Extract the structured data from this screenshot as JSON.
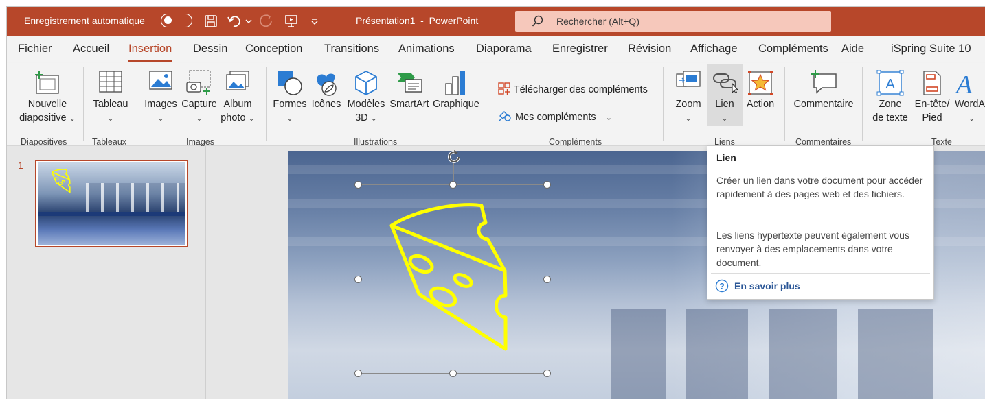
{
  "titlebar": {
    "autosave_label": "Enregistrement automatique",
    "doc_title": "Présentation1  -  PowerPoint",
    "search_placeholder": "Rechercher (Alt+Q)"
  },
  "tabs": [
    "Fichier",
    "Accueil",
    "Insertion",
    "Dessin",
    "Conception",
    "Transitions",
    "Animations",
    "Diaporama",
    "Enregistrer",
    "Révision",
    "Affichage",
    "Compléments",
    "Aide",
    "iSpring Suite 10"
  ],
  "active_tab": "Insertion",
  "ribbon": {
    "new_slide": [
      "Nouvelle",
      "diapositive"
    ],
    "table": "Tableau",
    "images": "Images",
    "capture": "Capture",
    "album": [
      "Album",
      "photo"
    ],
    "shapes": "Formes",
    "icons": "Icônes",
    "models3d": [
      "Modèles",
      "3D"
    ],
    "smartart": "SmartArt",
    "chart": "Graphique",
    "get_addins": "Télécharger des compléments",
    "my_addins": "Mes compléments",
    "zoom": "Zoom",
    "link": "Lien",
    "action": "Action",
    "comment": "Commentaire",
    "textbox": [
      "Zone",
      "de texte"
    ],
    "header_footer": [
      "En-tête/",
      "Pied"
    ],
    "wordart": "WordA",
    "groups": {
      "slides": "Diapositives",
      "tables": "Tableaux",
      "images": "Images",
      "illustrations": "Illustrations",
      "addins": "Compléments",
      "links": "Liens",
      "comments": "Commentaires",
      "text": "Texte"
    }
  },
  "thumbnails": {
    "slide_number": "1"
  },
  "tooltip": {
    "title": "Lien",
    "p1": "Créer un lien dans votre document pour accéder rapidement à des pages web et des fichiers.",
    "p2": "Les liens hypertexte peuvent également vous renvoyer à des emplacements dans votre document.",
    "help": "En savoir plus"
  },
  "colors": {
    "accent": "#b7472a",
    "cheese": "#ffff00",
    "link": "#2b5797"
  }
}
